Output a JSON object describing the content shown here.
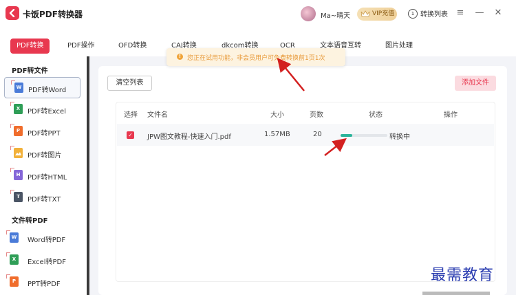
{
  "app": {
    "title": "卡饭PDF转换器"
  },
  "header": {
    "username": "Ma~晴天",
    "vip_label": "VIP充值",
    "convert_list_label": "转换列表",
    "convert_list_badge": "1"
  },
  "tabs": [
    {
      "label": "PDF转换",
      "active": true
    },
    {
      "label": "PDF操作"
    },
    {
      "label": "OFD转换"
    },
    {
      "label": "CAJ转换"
    },
    {
      "label": "dkcom转换"
    },
    {
      "label": "OCR"
    },
    {
      "label": "文本语音互转"
    },
    {
      "label": "图片处理"
    }
  ],
  "notice": {
    "text": "您正在试用功能，非会员用户可免费转换前1页1次"
  },
  "sidebar": {
    "section1": "PDF转文件",
    "section2": "文件转PDF",
    "items": [
      {
        "label": "PDF转Word",
        "icon": "W",
        "color": "#4a7bd8"
      },
      {
        "label": "PDF转Excel",
        "icon": "X",
        "color": "#2f9e57"
      },
      {
        "label": "PDF转PPT",
        "icon": "P",
        "color": "#f06d2c"
      },
      {
        "label": "PDF转图片",
        "icon": "img",
        "color": "#f2b13a"
      },
      {
        "label": "PDF转HTML",
        "icon": "H",
        "color": "#8566d8"
      },
      {
        "label": "PDF转TXT",
        "icon": "T",
        "color": "#4b5565"
      },
      {
        "label": "Word转PDF",
        "icon": "W",
        "color": "#4a7bd8"
      },
      {
        "label": "Excel转PDF",
        "icon": "X",
        "color": "#2f9e57"
      },
      {
        "label": "PPT转PDF",
        "icon": "P",
        "color": "#f06d2c"
      }
    ]
  },
  "main": {
    "clear_button": "清空列表",
    "add_button": "添加文件",
    "columns": [
      "选择",
      "文件名",
      "大小",
      "页数",
      "状态",
      "操作"
    ],
    "rows": [
      {
        "selected": true,
        "filename": "JPW图文教程-快速入门.pdf",
        "size": "1.57MB",
        "pages": "20",
        "progress": 0.25,
        "status": "转换中"
      }
    ]
  },
  "watermark": "最需教育",
  "colors": {
    "accent": "#e8384f",
    "progress": "#2bb59b",
    "annotation_arrow": "#d32020"
  }
}
